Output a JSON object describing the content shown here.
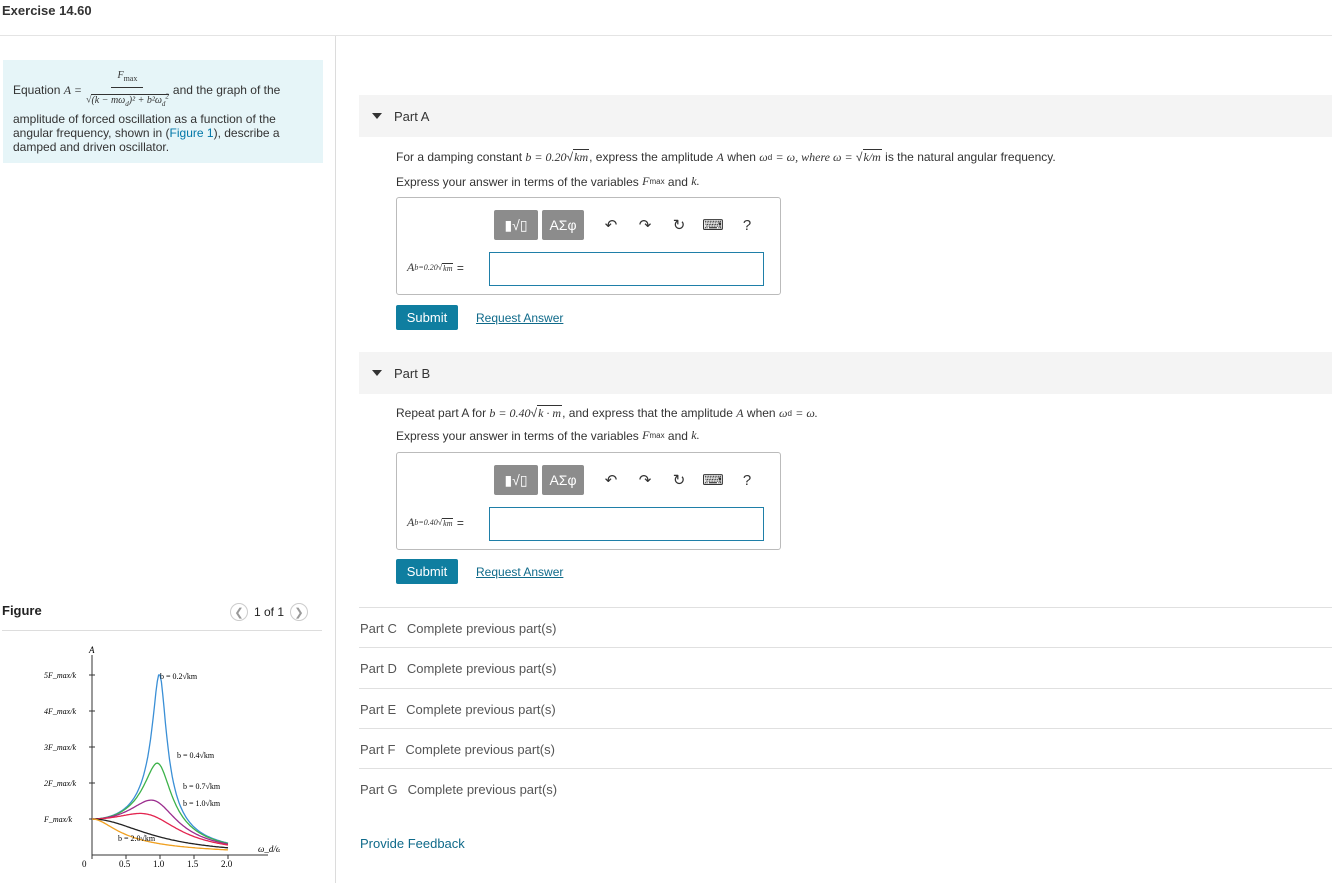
{
  "page": {
    "title": "Exercise 14.60"
  },
  "intro": {
    "prefix": "Equation",
    "var_A": "A =",
    "numerator": "F",
    "numerator_sub": "max",
    "denominator": "(k − mω",
    "denominator_rest": ")² + b²ω",
    "sub_d": "d",
    "sup_2": "2",
    "after": "and the graph of the",
    "body_1": "amplitude of forced oscillation as a function of the angular frequency, shown in (",
    "figure_link": "Figure 1",
    "body_2": "), describe a damped and driven oscillator."
  },
  "figure": {
    "heading": "Figure",
    "pager": "1 of 1",
    "prev_icon": "chevron-left-icon",
    "next_icon": "chevron-right-icon"
  },
  "chart_data": {
    "type": "line",
    "xlabel": "ω_d/ω",
    "ylabel": "A",
    "xticks": [
      "0",
      "0.5",
      "1.0",
      "1.5",
      "2.0"
    ],
    "yticks": [
      "F_max/k",
      "2F_max/k",
      "3F_max/k",
      "4F_max/k",
      "5F_max/k"
    ],
    "xlim": [
      0,
      2.0
    ],
    "ylim": [
      0,
      5
    ],
    "series": [
      {
        "name": "b = 0.2√km",
        "color": "#3a8fd6",
        "peak": [
          1.0,
          5.0
        ]
      },
      {
        "name": "b = 0.4√km",
        "color": "#3db24a",
        "peak": [
          0.98,
          2.5
        ]
      },
      {
        "name": "b = 0.7√km",
        "color": "#9b2d8e",
        "peak": [
          0.93,
          1.45
        ]
      },
      {
        "name": "b = 1.0√km",
        "color": "#e3244f",
        "peak": [
          0.87,
          1.15
        ]
      },
      {
        "name": "b = 2.0√km",
        "color": "#222222",
        "peak": [
          0.0,
          1.0
        ]
      },
      {
        "name": "",
        "color": "#f0a020",
        "peak": [
          0.0,
          1.0
        ]
      }
    ]
  },
  "partA": {
    "header": "Part A",
    "q1": "For a damping constant",
    "b_eq": "b = 0.20",
    "b_root": "km",
    "q2": ", express the amplitude",
    "A": "A",
    "q3": "when",
    "wd": "ω",
    "wd_sub": "d",
    "eq_w": "= ω, where ω =",
    "root_km": "k/m",
    "q4": "is the natural angular frequency.",
    "inst1": "Express your answer in terms of the variables",
    "Fmax": "F",
    "Fmax_sub": "max",
    "inst2": "and",
    "k": "k.",
    "answer_label": "A",
    "answer_sub": "b=0.20",
    "answer_root": "km",
    "answer_eq": "=",
    "submit": "Submit",
    "request": "Request Answer"
  },
  "partB": {
    "header": "Part B",
    "q1": "Repeat part A for",
    "b_eq": "b = 0.40",
    "b_root": "k · m",
    "q2": ", and express that the amplitude",
    "A": "A",
    "q3": "when",
    "wd": "ω",
    "wd_sub": "d",
    "eq_w": "= ω.",
    "inst1": "Express your answer in terms of the variables",
    "Fmax": "F",
    "Fmax_sub": "max",
    "inst2": "and",
    "k": "k.",
    "answer_label": "A",
    "answer_sub": "b=0.40",
    "answer_root": "km",
    "answer_eq": "=",
    "submit": "Submit",
    "request": "Request Answer"
  },
  "toolbar": {
    "templates_icon": "fraction-sqrt-template-icon",
    "greek_label": "ΑΣφ",
    "undo_icon": "undo-icon",
    "redo_icon": "redo-icon",
    "reset_icon": "reset-icon",
    "keyboard_icon": "keyboard-icon",
    "help": "?"
  },
  "locked_parts": [
    {
      "label": "Part C",
      "status": "Complete previous part(s)"
    },
    {
      "label": "Part D",
      "status": "Complete previous part(s)"
    },
    {
      "label": "Part E",
      "status": "Complete previous part(s)"
    },
    {
      "label": "Part F",
      "status": "Complete previous part(s)"
    },
    {
      "label": "Part G",
      "status": "Complete previous part(s)"
    }
  ],
  "feedback": "Provide Feedback"
}
